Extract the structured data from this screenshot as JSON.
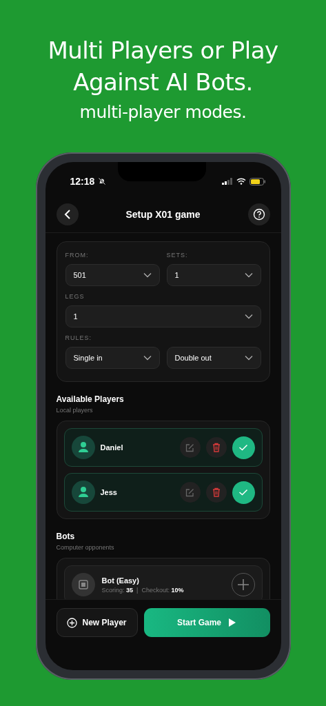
{
  "headline": {
    "lines": [
      "Multi Players or Play",
      "Against AI Bots."
    ],
    "subtitle": "multi-player modes."
  },
  "status_bar": {
    "time": "12:18",
    "muted": true
  },
  "nav": {
    "title": "Setup X01 game"
  },
  "settings": [
    {
      "label": "FROM:",
      "value": "501",
      "kind": "half"
    },
    {
      "label": "SETS:",
      "value": "1",
      "kind": "half"
    },
    {
      "label": "LEGS",
      "value": "1",
      "kind": "full"
    },
    {
      "label": "RULES:",
      "value": "Single in",
      "kind": "half"
    },
    {
      "value": "Double out",
      "kind": "half"
    }
  ],
  "players_section": {
    "title": "Available Players",
    "subtitle": "Local players"
  },
  "players": [
    {
      "name": "Daniel",
      "selected": true
    },
    {
      "name": "Jess",
      "selected": true
    }
  ],
  "bots_section": {
    "title": "Bots",
    "subtitle": "Computer opponents"
  },
  "bots": [
    {
      "name": "Bot (Easy)",
      "scoring_label": "Scoring:",
      "scoring": "35",
      "separator": "|",
      "checkout_label": "Checkout:",
      "checkout": "10%",
      "selected": false
    }
  ],
  "buttons": {
    "new_player": "New Player",
    "start": "Start Game"
  }
}
